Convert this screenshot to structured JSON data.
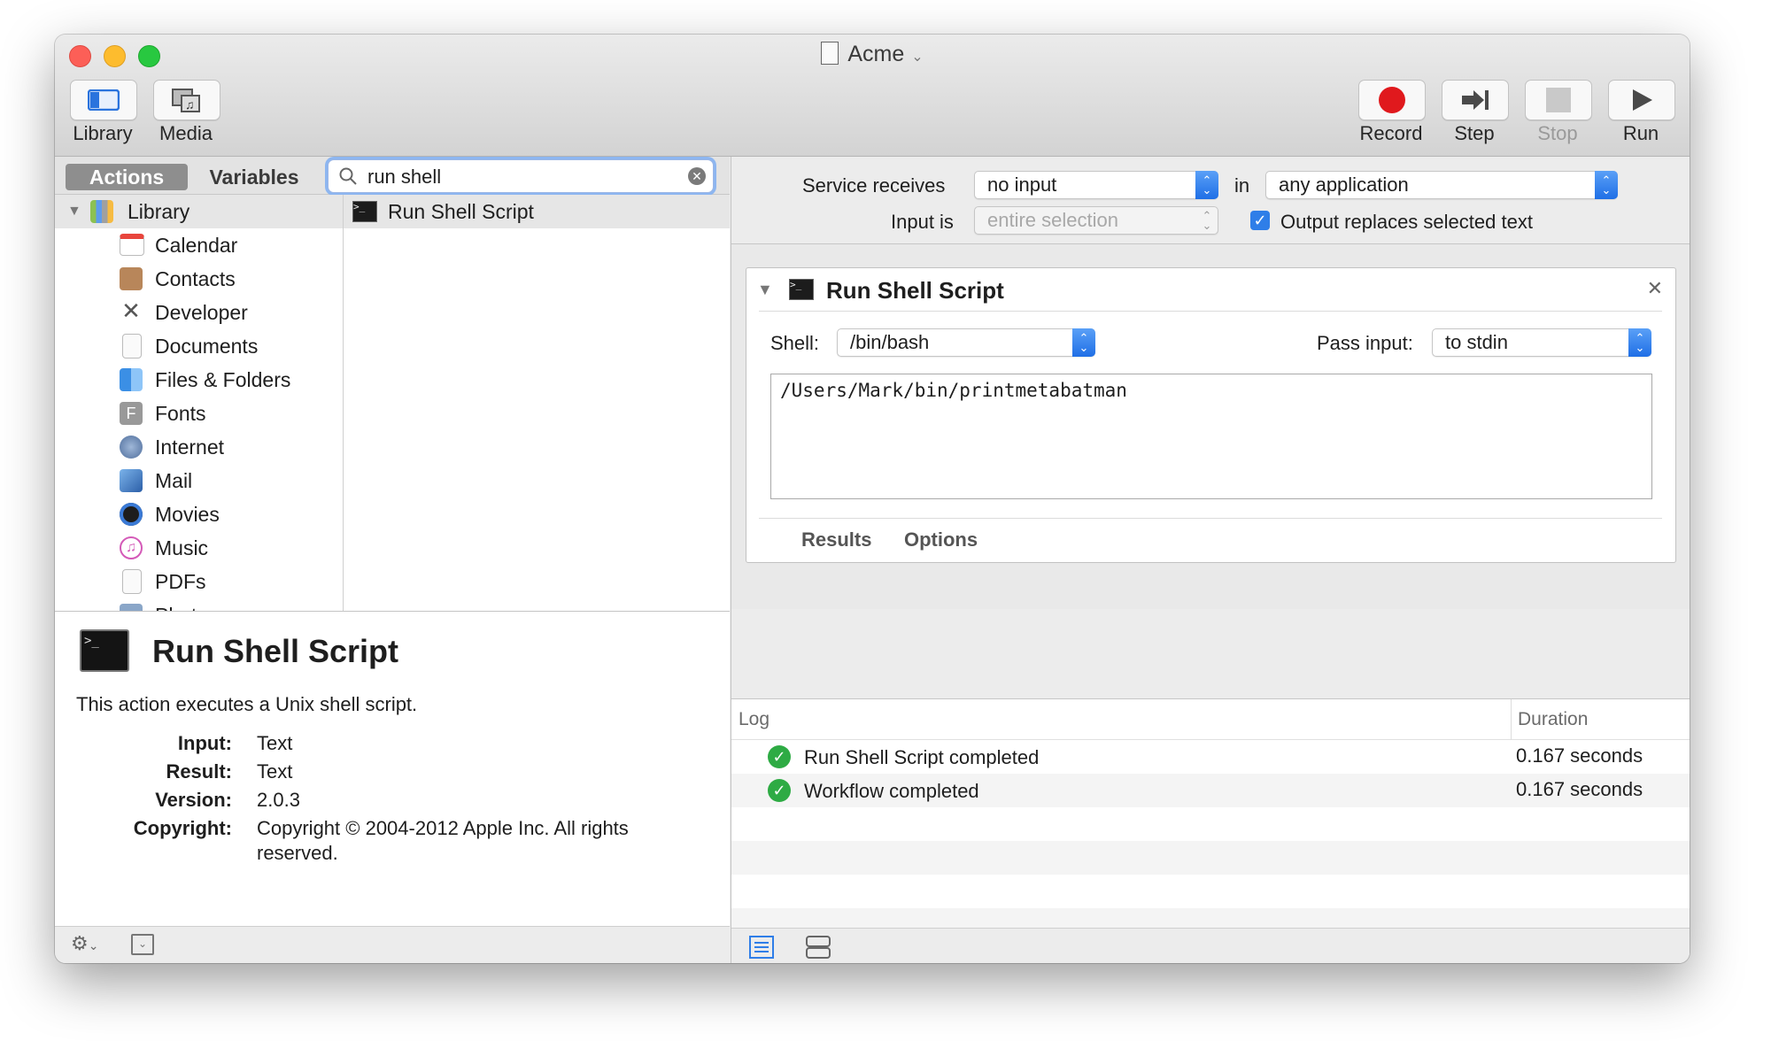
{
  "window": {
    "title": "Acme"
  },
  "toolbar": {
    "left": [
      {
        "label": "Library",
        "icon": "library-icon"
      },
      {
        "label": "Media",
        "icon": "media-icon"
      }
    ],
    "right": [
      {
        "label": "Record",
        "icon": "record-icon"
      },
      {
        "label": "Step",
        "icon": "step-icon"
      },
      {
        "label": "Stop",
        "icon": "stop-icon",
        "disabled": true
      },
      {
        "label": "Run",
        "icon": "run-icon"
      }
    ]
  },
  "library_pane": {
    "tabs": [
      "Actions",
      "Variables"
    ],
    "active_tab": "Actions",
    "search_value": "run shell",
    "root": "Library",
    "categories": [
      "Calendar",
      "Contacts",
      "Developer",
      "Documents",
      "Files & Folders",
      "Fonts",
      "Internet",
      "Mail",
      "Movies",
      "Music",
      "PDFs",
      "Photos"
    ],
    "results": [
      "Run Shell Script"
    ]
  },
  "description": {
    "title": "Run Shell Script",
    "summary": "This action executes a Unix shell script.",
    "input_label": "Input:",
    "input": "Text",
    "result_label": "Result:",
    "result": "Text",
    "version_label": "Version:",
    "version": "2.0.3",
    "copyright_label": "Copyright:",
    "copyright_line1": "Copyright © 2004-2012 Apple Inc.  All rights",
    "copyright_line2": "reserved."
  },
  "service": {
    "receives_label": "Service receives",
    "receives_value": "no input",
    "in_label": "in",
    "in_value": "any application",
    "input_is_label": "Input is",
    "input_is_value": "entire selection",
    "output_replaces_label": "Output replaces selected text",
    "output_replaces_checked": true
  },
  "action": {
    "title": "Run Shell Script",
    "shell_label": "Shell:",
    "shell_value": "/bin/bash",
    "pass_input_label": "Pass input:",
    "pass_input_value": "to stdin",
    "script": "/Users/Mark/bin/printmetabatman",
    "tabs": [
      "Results",
      "Options"
    ]
  },
  "log": {
    "col_log": "Log",
    "col_duration": "Duration",
    "rows": [
      {
        "message": "Run Shell Script completed",
        "duration": "0.167 seconds"
      },
      {
        "message": "Workflow completed",
        "duration": "0.167 seconds"
      }
    ]
  },
  "colors": {
    "accent": "#1f6fe6",
    "record": "#e0191d",
    "success": "#2eab44"
  }
}
